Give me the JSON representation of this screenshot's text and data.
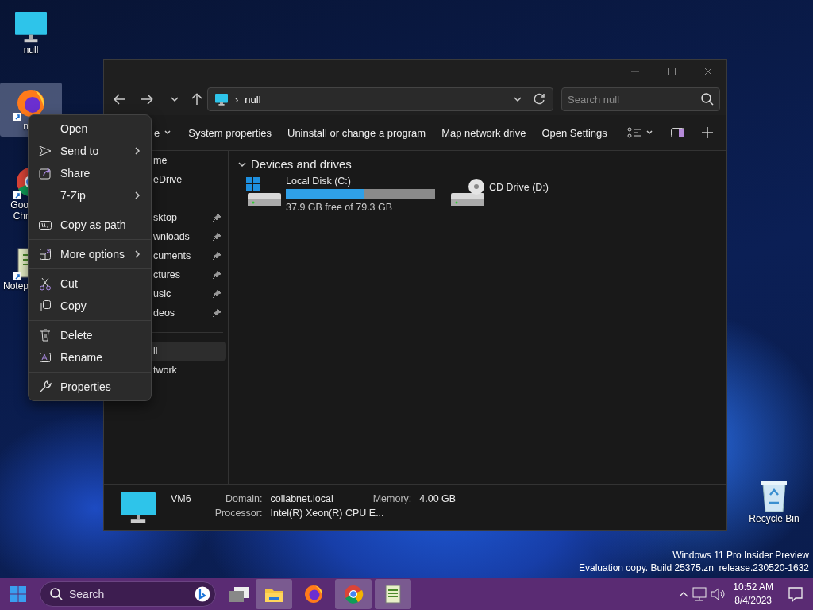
{
  "desktop_icons": [
    {
      "label_lines": [
        "null"
      ],
      "selected": false,
      "shortcut": false
    },
    {
      "label_lines": [
        "n"
      ],
      "selected": true,
      "shortcut": true
    },
    {
      "label_lines": [
        "Goo",
        "Chr"
      ],
      "selected": false,
      "shortcut": true
    },
    {
      "label_lines": [
        "Notep"
      ],
      "selected": false,
      "shortcut": true
    }
  ],
  "recycle_bin": {
    "label": "Recycle Bin"
  },
  "window": {
    "address": {
      "separator": "›",
      "location": "null"
    },
    "search": {
      "placeholder": "Search null"
    },
    "command_bar": [
      {
        "label": "e",
        "dropdown": true
      },
      {
        "label": "System properties",
        "dropdown": false
      },
      {
        "label": "Uninstall or change a program",
        "dropdown": false
      },
      {
        "label": "Map network drive",
        "dropdown": false
      },
      {
        "label": "Open Settings",
        "dropdown": false
      }
    ],
    "nav_groups": [
      [
        {
          "label": "me",
          "pinned": false,
          "selected": false
        },
        {
          "label": "eDrive",
          "pinned": false,
          "selected": false
        }
      ],
      [
        {
          "label": "sktop",
          "pinned": true,
          "selected": false
        },
        {
          "label": "wnloads",
          "pinned": true,
          "selected": false
        },
        {
          "label": "cuments",
          "pinned": true,
          "selected": false
        },
        {
          "label": "ctures",
          "pinned": true,
          "selected": false
        },
        {
          "label": "usic",
          "pinned": true,
          "selected": false
        },
        {
          "label": "deos",
          "pinned": true,
          "selected": false
        }
      ],
      [
        {
          "label": "ll",
          "pinned": false,
          "selected": true
        },
        {
          "label": "twork",
          "pinned": false,
          "selected": false
        }
      ]
    ],
    "section": {
      "title": "Devices and drives",
      "expanded": true
    },
    "drives": [
      {
        "kind": "disk",
        "name": "Local Disk (C:)",
        "level": 0.52,
        "free": "37.9 GB free of 79.3 GB"
      },
      {
        "kind": "cd",
        "name": "CD Drive (D:)"
      }
    ],
    "details": {
      "name": "VM6",
      "fields": [
        {
          "label": "Domain:",
          "value": "collabnet.local"
        },
        {
          "label": "Memory:",
          "value": "4.00 GB"
        },
        {
          "label": "Processor:",
          "value": "Intel(R) Xeon(R) CPU E..."
        }
      ]
    }
  },
  "context_menu": [
    [
      {
        "label": "Open",
        "submenu": false
      },
      {
        "label": "Send to",
        "submenu": true
      },
      {
        "label": "Share",
        "submenu": false
      },
      {
        "label": "7-Zip",
        "submenu": true
      }
    ],
    [
      {
        "label": "Copy as path",
        "submenu": false
      }
    ],
    [
      {
        "label": "More options",
        "submenu": true
      }
    ],
    [
      {
        "label": "Cut",
        "submenu": false
      },
      {
        "label": "Copy",
        "submenu": false
      }
    ],
    [
      {
        "label": "Delete",
        "submenu": false
      },
      {
        "label": "Rename",
        "submenu": false
      }
    ],
    [
      {
        "label": "Properties",
        "submenu": false
      }
    ]
  ],
  "watermark": [
    "Windows 11 Pro Insider Preview",
    "Evaluation copy. Build 25375.zn_release.230520-1632"
  ],
  "taskbar": {
    "search": {
      "placeholder": "Search"
    },
    "apps": [
      {
        "kind": "explorer",
        "active": true
      },
      {
        "kind": "firefox",
        "active": false
      },
      {
        "kind": "chrome",
        "active": true
      },
      {
        "kind": "notepad",
        "active": true
      }
    ],
    "time": "10:52 AM",
    "date": "8/4/2023"
  }
}
